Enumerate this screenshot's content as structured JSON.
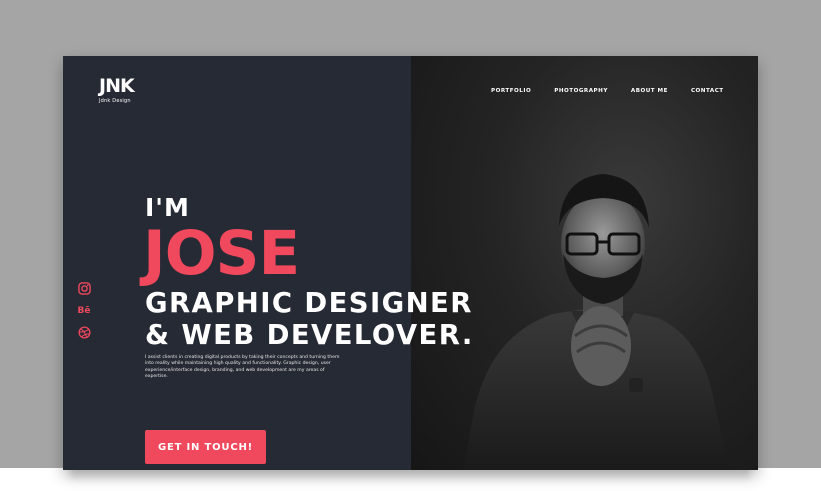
{
  "logo": {
    "mark": "JNK",
    "text": "Jdnk Design"
  },
  "nav": {
    "items": [
      "PORTFOLIO",
      "PHOTOGRAPHY",
      "ABOUT ME",
      "CONTACT"
    ]
  },
  "social": {
    "icons": [
      "instagram-icon",
      "behance-icon",
      "dribbble-icon"
    ],
    "behance_glyph": "Bē"
  },
  "hero": {
    "pre": "I'M",
    "name": "JOSE",
    "title_line1": "GRAPHIC DESIGNER",
    "title_line2": "& WEB DEVELOVER.",
    "description": "I assist clients in creating digital products by taking their concepts and turning them into reality while maintaining high quality and functionality. Graphic design, user experience/interface design, branding, and web development are my areas of expertise.",
    "cta_label": "GET IN TOUCH!"
  },
  "colors": {
    "accent": "#f0485d",
    "left_bg": "#262a35",
    "right_bg": "#1c1c1c",
    "page_bg": "#a5a5a5"
  }
}
